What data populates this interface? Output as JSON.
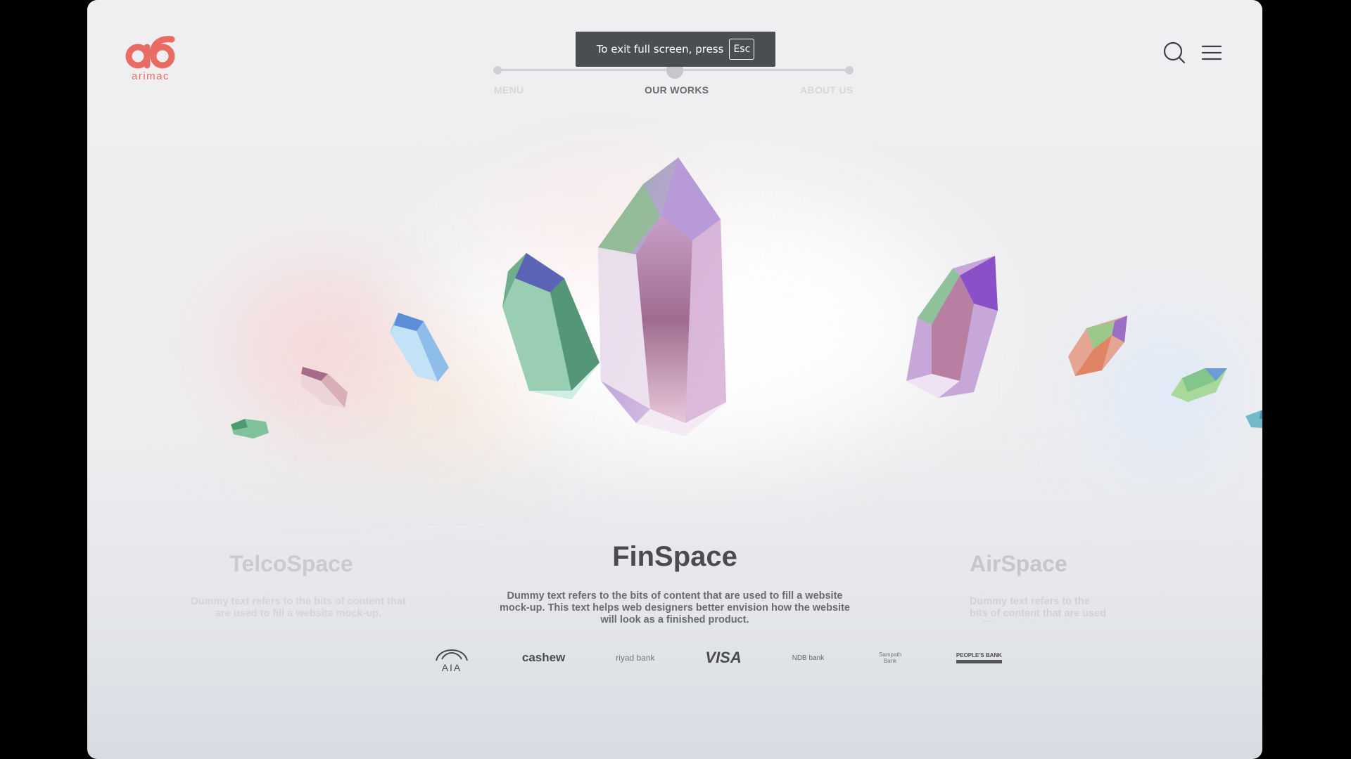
{
  "brand": {
    "logo_text": "arimac",
    "accent": "#e86c63"
  },
  "fullscreen_toast": {
    "message": "To exit full screen, press",
    "key": "Esc"
  },
  "nav": {
    "items": [
      {
        "label": "MENU"
      },
      {
        "label": "OUR WORKS"
      },
      {
        "label": "ABOUT US"
      }
    ],
    "active_index": 1
  },
  "header_icons": {
    "search": "search-icon",
    "menu": "hamburger-menu-icon"
  },
  "cards": {
    "left": {
      "title": "TelcoSpace",
      "description": "Dummy text refers to the bits of content that are used to fill a website mock-up."
    },
    "center": {
      "title": "FinSpace",
      "description": "Dummy text refers to the bits of content that are used to fill a website mock-up. This text helps web designers better envision how the website will look as a finished product."
    },
    "right": {
      "title": "AirSpace",
      "description": "Dummy text refers to the bits of content that are used to fill a website mock-up."
    }
  },
  "client_logos": [
    {
      "name": "aia-logo",
      "text": "AIA"
    },
    {
      "name": "cashew-logo",
      "text": "cashew"
    },
    {
      "name": "riyad-bank-logo",
      "text": "riyad bank"
    },
    {
      "name": "visa-logo",
      "text": "VISA"
    },
    {
      "name": "ndb-bank-logo",
      "text": "NDB bank"
    },
    {
      "name": "sampath-bank-logo",
      "text": "Sampath Bank"
    },
    {
      "name": "peoples-bank-logo",
      "text": "PEOPLE'S BANK"
    }
  ]
}
